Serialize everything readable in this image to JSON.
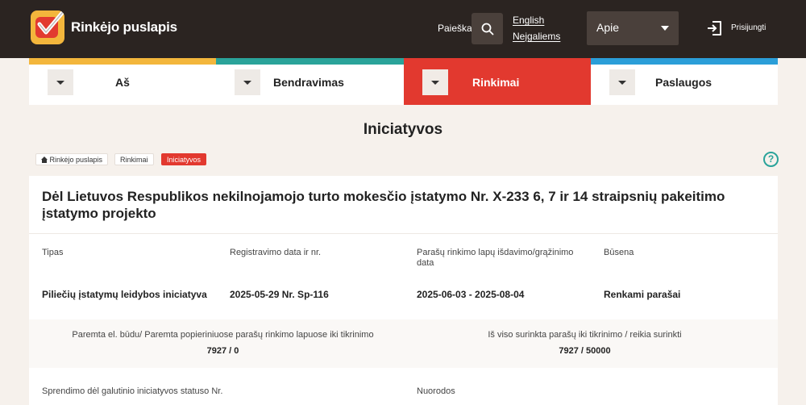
{
  "header": {
    "site_name": "Rinkėjo puslapis",
    "search_label": "Paieška",
    "lang_english": "English",
    "lang_disabled": "Neįgaliems",
    "about_label": "Apie",
    "login_label": "Prisijungti"
  },
  "nav": {
    "items": [
      {
        "label": "Aš",
        "color": "#f3b63c"
      },
      {
        "label": "Bendravimas",
        "color": "#2aa39a"
      },
      {
        "label": "Rinkimai",
        "color": "#e2392f"
      },
      {
        "label": "Paslaugos",
        "color": "#2b9ed8"
      }
    ]
  },
  "page": {
    "title": "Iniciatyvos"
  },
  "breadcrumb": {
    "home": "Rinkėjo puslapis",
    "section": "Rinkimai",
    "current": "Iniciatyvos"
  },
  "help_label": "?",
  "card": {
    "title": "Dėl Lietuvos Respublikos nekilnojamojo turto mokesčio įstatymo Nr. X-233 6, 7 ir 14 straipsnių pakeitimo įstatymo projekto",
    "type_label": "Tipas",
    "type_value": "Piliečių įstatymų leidybos iniciatyva",
    "reg_label": "Registravimo data ir nr.",
    "reg_value": "2025-05-29 Nr. Sp-116",
    "sig_label": "Parašų rinkimo lapų išdavimo/grąžinimo data",
    "sig_value": "2025-06-03 - 2025-08-04",
    "status_label": "Būsena",
    "status_value": "Renkami parašai",
    "supported_label": "Paremta el. būdu/ Paremta popieriniuose parašų rinkimo lapuose iki tikrinimo",
    "supported_value": "7927 / 0",
    "collected_label": "Iš viso surinkta parašų iki tikrinimo / reikia surinkti",
    "collected_value": "7927 / 50000",
    "decision_label": "Sprendimo dėl galutinio iniciatyvos statuso Nr.",
    "links_label": "Nuorodos"
  },
  "colors": {
    "header_bg": "#2b2421",
    "accent_red": "#e2392f",
    "accent_teal": "#2aa39a",
    "accent_yellow": "#f3b63c",
    "accent_blue": "#2b9ed8",
    "page_bg": "#f6f1ec"
  }
}
